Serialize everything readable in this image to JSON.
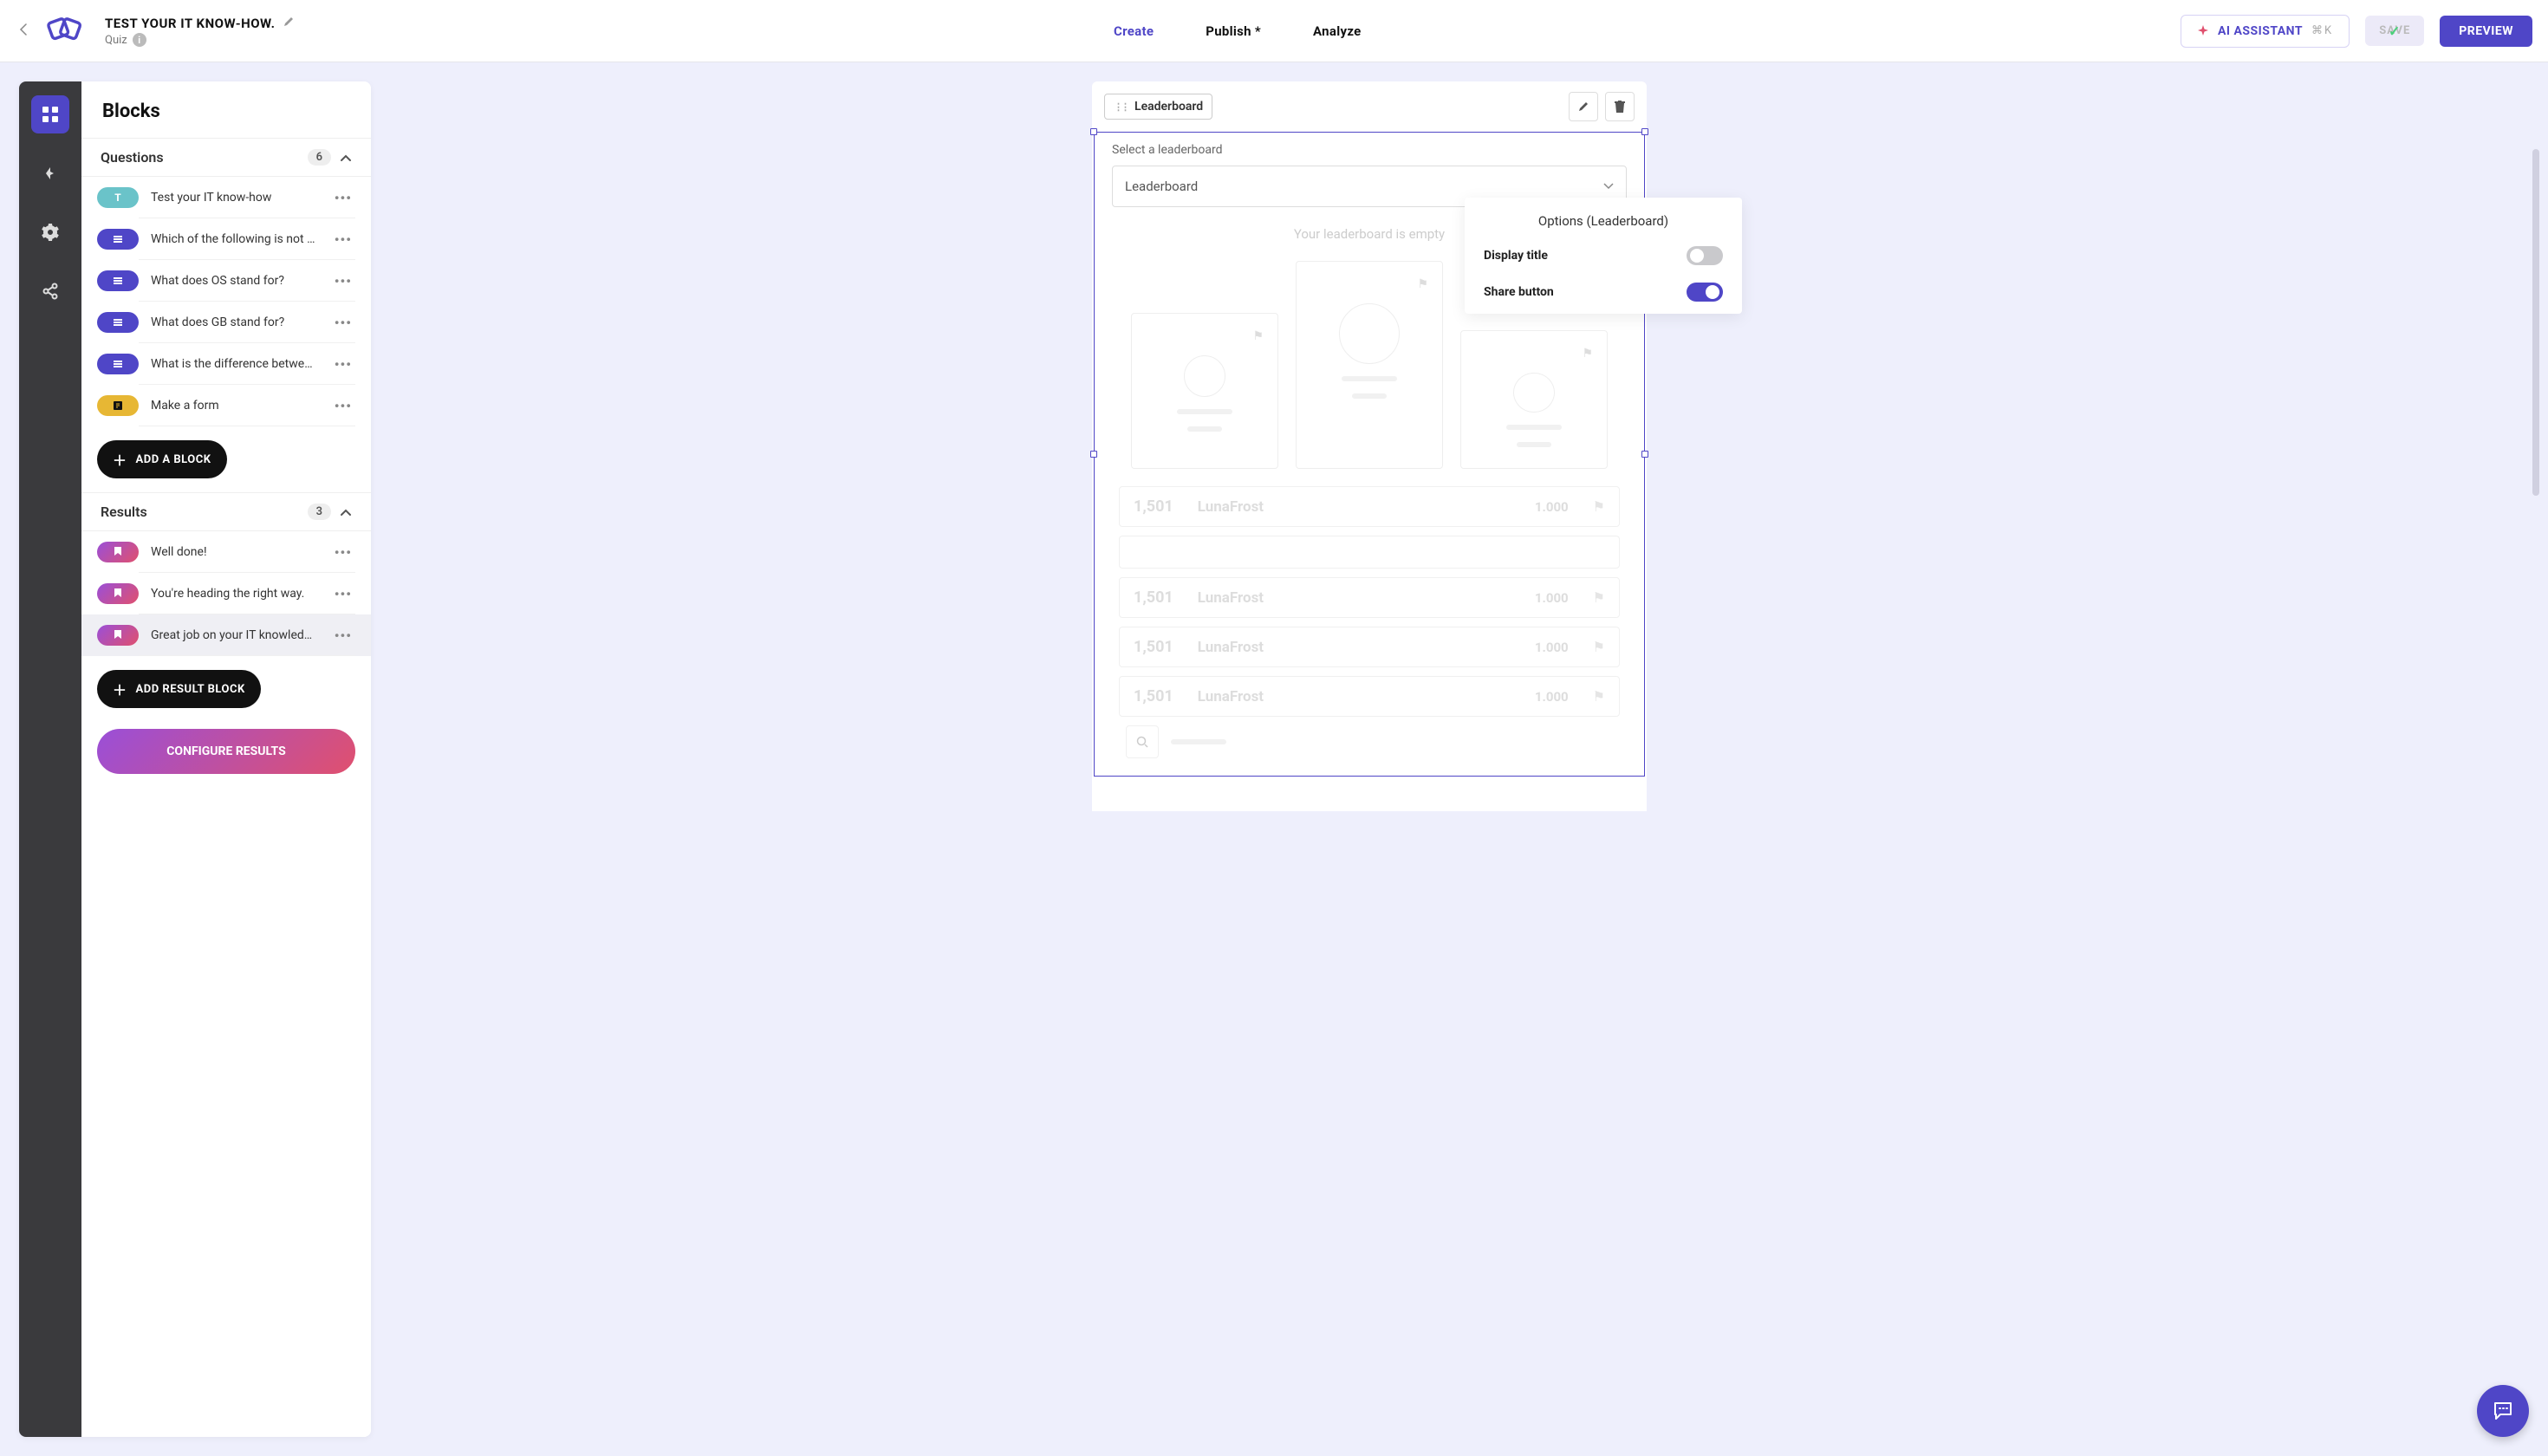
{
  "header": {
    "title": "TEST YOUR IT KNOW-HOW.",
    "subtitle": "Quiz",
    "nav": {
      "create": "Create",
      "publish": "Publish *",
      "analyze": "Analyze"
    },
    "ai_label": "AI ASSISTANT",
    "ai_kbd": "⌘K",
    "save": "SAVE",
    "preview": "PREVIEW"
  },
  "sidebar": {
    "title": "Blocks",
    "questions": {
      "heading": "Questions",
      "count": "6",
      "items": [
        {
          "label": "Test your IT know-how",
          "kind": "T",
          "style": "teal"
        },
        {
          "label": "Which of the following is not …",
          "kind": "list",
          "style": "purple"
        },
        {
          "label": "What does OS stand for?",
          "kind": "list",
          "style": "purple"
        },
        {
          "label": "What does GB stand for?",
          "kind": "list",
          "style": "purple"
        },
        {
          "label": "What is the difference betwe…",
          "kind": "list",
          "style": "purple"
        },
        {
          "label": "Make a form",
          "kind": "form",
          "style": "gold"
        }
      ],
      "add": "ADD A BLOCK"
    },
    "results": {
      "heading": "Results",
      "count": "3",
      "items": [
        {
          "label": "Well done!",
          "style": "grad"
        },
        {
          "label": "You're heading the right way.",
          "style": "grad"
        },
        {
          "label": "Great job on your IT knowled…",
          "style": "grad",
          "selected": true
        }
      ],
      "add": "ADD RESULT BLOCK"
    },
    "configure": "CONFIGURE RESULTS"
  },
  "canvas": {
    "block_tag": "Leaderboard",
    "select_label": "Select a leaderboard",
    "select_value": "Leaderboard",
    "empty_desc": "Your leaderboard is empty",
    "rows": [
      {
        "rank": "1,501",
        "name": "LunaFrost",
        "score": "1.000"
      },
      {
        "rank": "1,501",
        "name": "LunaFrost",
        "score": "1.000"
      },
      {
        "rank": "1,501",
        "name": "LunaFrost",
        "score": "1.000"
      },
      {
        "rank": "1,501",
        "name": "LunaFrost",
        "score": "1.000"
      }
    ]
  },
  "popover": {
    "title": "Options (Leaderboard)",
    "opt1": "Display title",
    "opt2": "Share button"
  }
}
